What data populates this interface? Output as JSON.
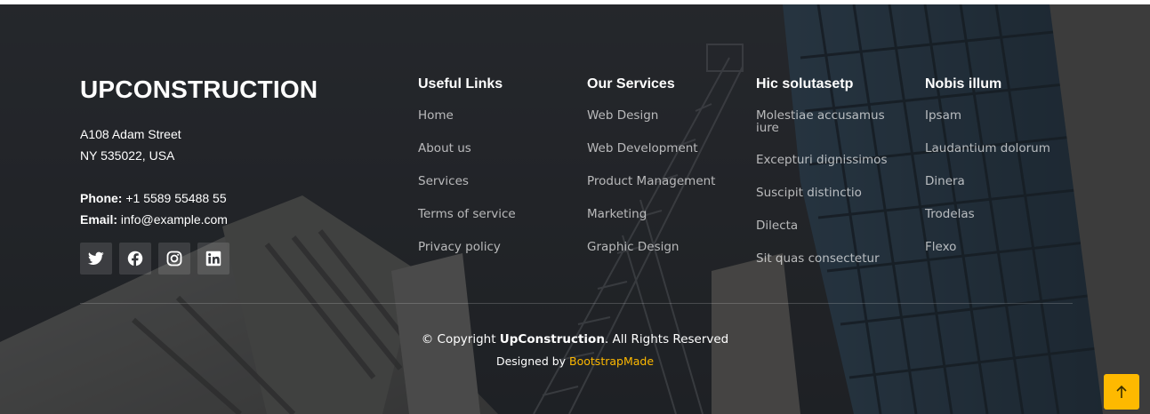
{
  "brand": {
    "name": "UPCONSTRUCTION"
  },
  "address": {
    "line1": "A108 Adam Street",
    "line2": "NY 535022, USA"
  },
  "contact": {
    "phone_label": "Phone:",
    "phone_value": "+1 5589 55488 55",
    "email_label": "Email:",
    "email_value": "info@example.com"
  },
  "social": [
    {
      "icon": "twitter-icon"
    },
    {
      "icon": "facebook-icon"
    },
    {
      "icon": "instagram-icon"
    },
    {
      "icon": "linkedin-icon"
    }
  ],
  "columns": [
    {
      "title": "Useful Links",
      "items": [
        "Home",
        "About us",
        "Services",
        "Terms of service",
        "Privacy policy"
      ]
    },
    {
      "title": "Our Services",
      "items": [
        "Web Design",
        "Web Development",
        "Product Management",
        "Marketing",
        "Graphic Design"
      ]
    },
    {
      "title": "Hic solutasetp",
      "items": [
        "Molestiae accusamus iure",
        "Excepturi dignissimos",
        "Suscipit distinctio",
        "Dilecta",
        "Sit quas consectetur"
      ]
    },
    {
      "title": "Nobis illum",
      "items": [
        "Ipsam",
        "Laudantium dolorum",
        "Dinera",
        "Trodelas",
        "Flexo"
      ]
    }
  ],
  "copyright": {
    "prefix": "© Copyright ",
    "brand": "UpConstruction",
    "suffix": ". All Rights Reserved"
  },
  "credits": {
    "prefix": "Designed by ",
    "link": "BootstrapMade"
  },
  "colors": {
    "accent": "#feb900",
    "background": "#2a2c30"
  },
  "scroll_top": {
    "icon": "arrow-up-icon"
  }
}
